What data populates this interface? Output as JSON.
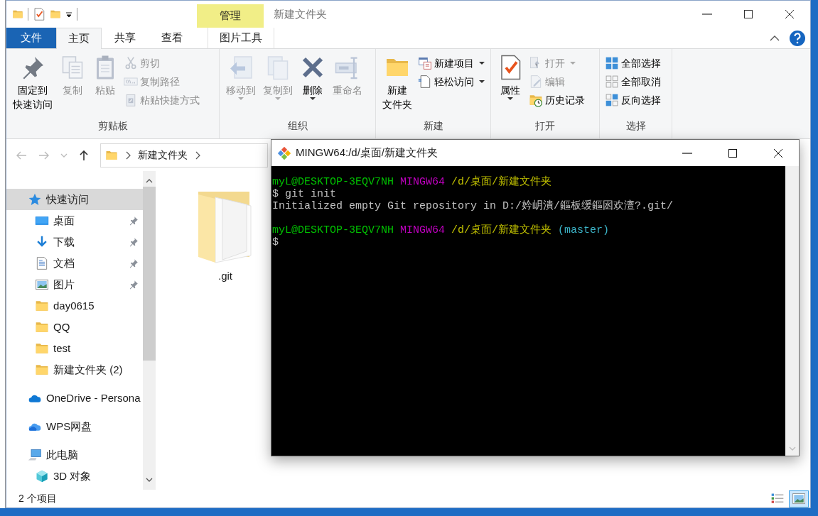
{
  "explorer": {
    "title": "新建文件夹",
    "contextual_group": "管理",
    "tabs": [
      {
        "label": "文件",
        "kind": "file",
        "selected": false
      },
      {
        "label": "主页",
        "kind": "normal",
        "selected": true
      },
      {
        "label": "共享",
        "kind": "normal",
        "selected": false
      },
      {
        "label": "查看",
        "kind": "normal",
        "selected": false
      },
      {
        "label": "图片工具",
        "kind": "contextual",
        "selected": false
      }
    ],
    "ribbon": [
      {
        "label": "剪贴板",
        "commands": [
          {
            "label": [
              "固定到",
              "快速访问"
            ],
            "kind": "large",
            "disabled": false,
            "dropdown": false
          },
          {
            "label": "复制",
            "kind": "large",
            "disabled": true,
            "dropdown": false
          },
          {
            "label": "粘贴",
            "kind": "large",
            "disabled": true,
            "dropdown": false
          },
          {
            "label": "剪切",
            "kind": "small",
            "disabled": true,
            "dropdown": false
          },
          {
            "label": "复制路径",
            "kind": "small",
            "disabled": true,
            "dropdown": false
          },
          {
            "label": "粘贴快捷方式",
            "kind": "small",
            "disabled": true,
            "dropdown": false
          }
        ]
      },
      {
        "label": "组织",
        "commands": [
          {
            "label": "移动到",
            "kind": "large",
            "disabled": true,
            "dropdown": true
          },
          {
            "label": "复制到",
            "kind": "large",
            "disabled": true,
            "dropdown": true
          },
          {
            "label": "删除",
            "kind": "large",
            "disabled": false,
            "dropdown": true
          },
          {
            "label": "重命名",
            "kind": "large",
            "disabled": true,
            "dropdown": false
          }
        ]
      },
      {
        "label": "新建",
        "commands": [
          {
            "label": [
              "新建",
              "文件夹"
            ],
            "kind": "large",
            "disabled": false,
            "dropdown": false
          },
          {
            "label": "新建项目",
            "kind": "small",
            "disabled": false,
            "dropdown": true
          },
          {
            "label": "轻松访问",
            "kind": "small",
            "disabled": false,
            "dropdown": true
          }
        ]
      },
      {
        "label": "打开",
        "commands": [
          {
            "label": "属性",
            "kind": "large",
            "disabled": false,
            "dropdown": true
          },
          {
            "label": "打开",
            "kind": "small",
            "disabled": true,
            "dropdown": true
          },
          {
            "label": "编辑",
            "kind": "small",
            "disabled": true,
            "dropdown": false
          },
          {
            "label": "历史记录",
            "kind": "small",
            "disabled": false,
            "dropdown": false
          }
        ]
      },
      {
        "label": "选择",
        "commands": [
          {
            "label": "全部选择",
            "kind": "small",
            "disabled": false,
            "dropdown": false
          },
          {
            "label": "全部取消",
            "kind": "small",
            "disabled": false,
            "dropdown": false
          },
          {
            "label": "反向选择",
            "kind": "small",
            "disabled": false,
            "dropdown": false
          }
        ]
      }
    ],
    "address": {
      "path": [
        "新建文件夹"
      ]
    },
    "nav": [
      {
        "label": "快速访问",
        "kind": "quick_access",
        "selected": true,
        "pinned": false,
        "children": [
          {
            "label": "桌面",
            "kind": "desktop",
            "selected": false,
            "pinned": true
          },
          {
            "label": "下载",
            "kind": "downloads",
            "selected": false,
            "pinned": true
          },
          {
            "label": "文档",
            "kind": "documents",
            "selected": false,
            "pinned": true
          },
          {
            "label": "图片",
            "kind": "pictures",
            "selected": false,
            "pinned": true
          },
          {
            "label": "day0615",
            "kind": "folder",
            "selected": false,
            "pinned": false
          },
          {
            "label": "QQ",
            "kind": "folder",
            "selected": false,
            "pinned": false
          },
          {
            "label": "test",
            "kind": "folder",
            "selected": false,
            "pinned": false
          },
          {
            "label": "新建文件夹 (2)",
            "kind": "folder",
            "selected": false,
            "pinned": false
          }
        ]
      },
      {
        "label": "OneDrive - Persona",
        "kind": "onedrive",
        "selected": false,
        "pinned": false
      },
      {
        "label": "WPS网盘",
        "kind": "cloud",
        "selected": false,
        "pinned": false
      },
      {
        "label": "此电脑",
        "kind": "pc",
        "selected": false,
        "pinned": false,
        "children": [
          {
            "label": "3D 对象",
            "kind": "objects3d",
            "selected": false,
            "pinned": false
          }
        ]
      }
    ],
    "files": [
      {
        "name": ".git"
      }
    ],
    "status_bar": {
      "text": "2 个项目",
      "views": [
        {
          "selected": false
        },
        {
          "selected": true
        }
      ]
    }
  },
  "terminal": {
    "title": "MINGW64:/d/桌面/新建文件夹",
    "lines": [
      {
        "kind": "text",
        "segments": [
          {
            "text": "myL@DESKTOP-3EQV7NH",
            "color": "#00c000"
          },
          {
            "text": "MINGW64",
            "color": "#c000c0"
          },
          {
            "text": "/d/桌面/新建文件夹",
            "color": "#c0c000"
          }
        ]
      },
      {
        "kind": "text",
        "segments": [
          {
            "text": "$ git init",
            "color": "#c0c0c0"
          }
        ]
      },
      {
        "kind": "text",
        "segments": [
          {
            "text": "Initialized empty Git repository in D:/妗岄潰/鏂板缓鏂囦欢澶?.git/",
            "color": "#c0c0c0"
          }
        ]
      },
      {
        "kind": "blank"
      },
      {
        "kind": "text",
        "segments": [
          {
            "text": "myL@DESKTOP-3EQV7NH",
            "color": "#00c000"
          },
          {
            "text": "MINGW64",
            "color": "#c000c0"
          },
          {
            "text": "/d/桌面/新建文件夹",
            "color": "#c0c000"
          },
          {
            "text": "(master)",
            "color": "#3cb4c8"
          }
        ]
      },
      {
        "kind": "text",
        "segments": [
          {
            "text": "$",
            "color": "#c0c0c0"
          }
        ]
      }
    ]
  }
}
